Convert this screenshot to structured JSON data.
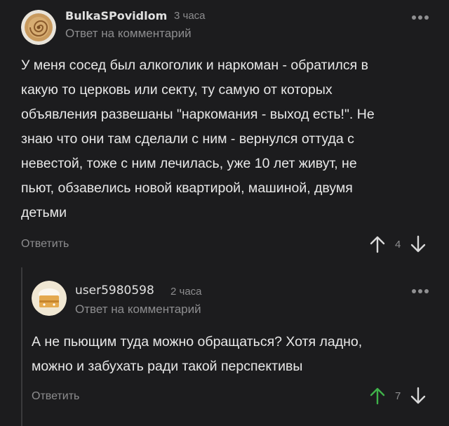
{
  "comments": [
    {
      "author": "BulkaSPovidlom",
      "time": "3 часа",
      "reply_tag": "Ответ на комментарий",
      "text": "У меня сосед был алкоголик и наркоман - обратился в\nкакую то церковь или секту, ту самую от которых\nобъявления развешаны \"наркомания - выход есть!\". Не\nзнаю что они там сделали с ним - вернулся оттуда с\nневестой, тоже с ним лечилась, уже 10 лет живут, не\nпьют, обзавелись новой квартирой, машиной, двумя\nдетьми",
      "reply_label": "Ответить",
      "votes": "4",
      "upvoted": false
    },
    {
      "author": "user5980598",
      "time": "2 часа",
      "reply_tag": "Ответ на комментарий",
      "text": "А не пьющим туда можно обращаться? Хотя ладно,\nможно и забухать ради такой перспективы",
      "reply_label": "Ответить",
      "votes": "7",
      "upvoted": true
    }
  ],
  "colors": {
    "background": "#1c1c1e",
    "upvote_active": "#3fb24a",
    "muted": "#8d8d8f"
  },
  "icons": [
    "bun-avatar",
    "cake-avatar",
    "more-dots-icon",
    "arrow-up-icon",
    "arrow-down-icon"
  ]
}
